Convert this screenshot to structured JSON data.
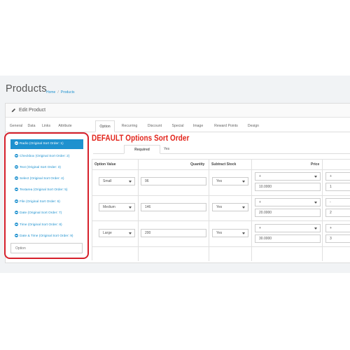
{
  "header": {
    "title": "Products",
    "breadcrumb": {
      "home": "Home",
      "separator": "/",
      "current": "Products"
    }
  },
  "panel": {
    "heading": "Edit Product",
    "icon": "pencil-icon"
  },
  "tabs": [
    {
      "label": "General",
      "active": false
    },
    {
      "label": "Data",
      "active": false
    },
    {
      "label": "Links",
      "active": false
    },
    {
      "label": "Attribute",
      "active": false
    },
    {
      "label": "Option",
      "active": true
    },
    {
      "label": "Recurring",
      "active": false
    },
    {
      "label": "Discount",
      "active": false
    },
    {
      "label": "Special",
      "active": false
    },
    {
      "label": "Image",
      "active": false
    },
    {
      "label": "Reward Points",
      "active": false
    },
    {
      "label": "Design",
      "active": false
    }
  ],
  "options": {
    "items": [
      {
        "label": "Radio (Original Sort Order: 1)",
        "active": true
      },
      {
        "label": "Checkbox (Original Sort Order: 2)",
        "active": false
      },
      {
        "label": "Text (Original Sort Order: 3)",
        "active": false
      },
      {
        "label": "Select (Original Sort Order: 4)",
        "active": false
      },
      {
        "label": "Textarea (Original Sort Order: 5)",
        "active": false
      },
      {
        "label": "File (Original Sort Order: 6)",
        "active": false
      },
      {
        "label": "Date (Original Sort Order: 7)",
        "active": false
      },
      {
        "label": "Time (Original Sort Order: 8)",
        "active": false
      },
      {
        "label": "Date & Time (Original Sort Order: 9)",
        "active": false
      }
    ],
    "input_placeholder": "Option"
  },
  "annotation": {
    "text": "DEFAULT Options Sort Order",
    "color": "#e2231a"
  },
  "subtabs": [
    {
      "label": "Required",
      "active": true
    },
    {
      "label": "Yes",
      "active": false
    }
  ],
  "table": {
    "headers": {
      "option_value": "Option Value",
      "quantity": "Quantity",
      "subtract": "Subtract Stock",
      "price": "Price"
    },
    "rows": [
      {
        "option_value": "Small",
        "quantity": "96",
        "subtract": "Yes",
        "price_prefix": "+",
        "price": "10.0000",
        "points_prefix": "+",
        "points": "1"
      },
      {
        "option_value": "Medium",
        "quantity": "146",
        "subtract": "Yes",
        "price_prefix": "+",
        "price": "20.0000",
        "points_prefix": "-",
        "points": "2"
      },
      {
        "option_value": "Large",
        "quantity": "200",
        "subtract": "Yes",
        "price_prefix": "+",
        "price": "30.0000",
        "points_prefix": "+",
        "points": "3"
      }
    ]
  },
  "colors": {
    "accent": "#1e91cf",
    "highlight_border": "#d6202b",
    "page_bg": "#f1f3f5"
  }
}
